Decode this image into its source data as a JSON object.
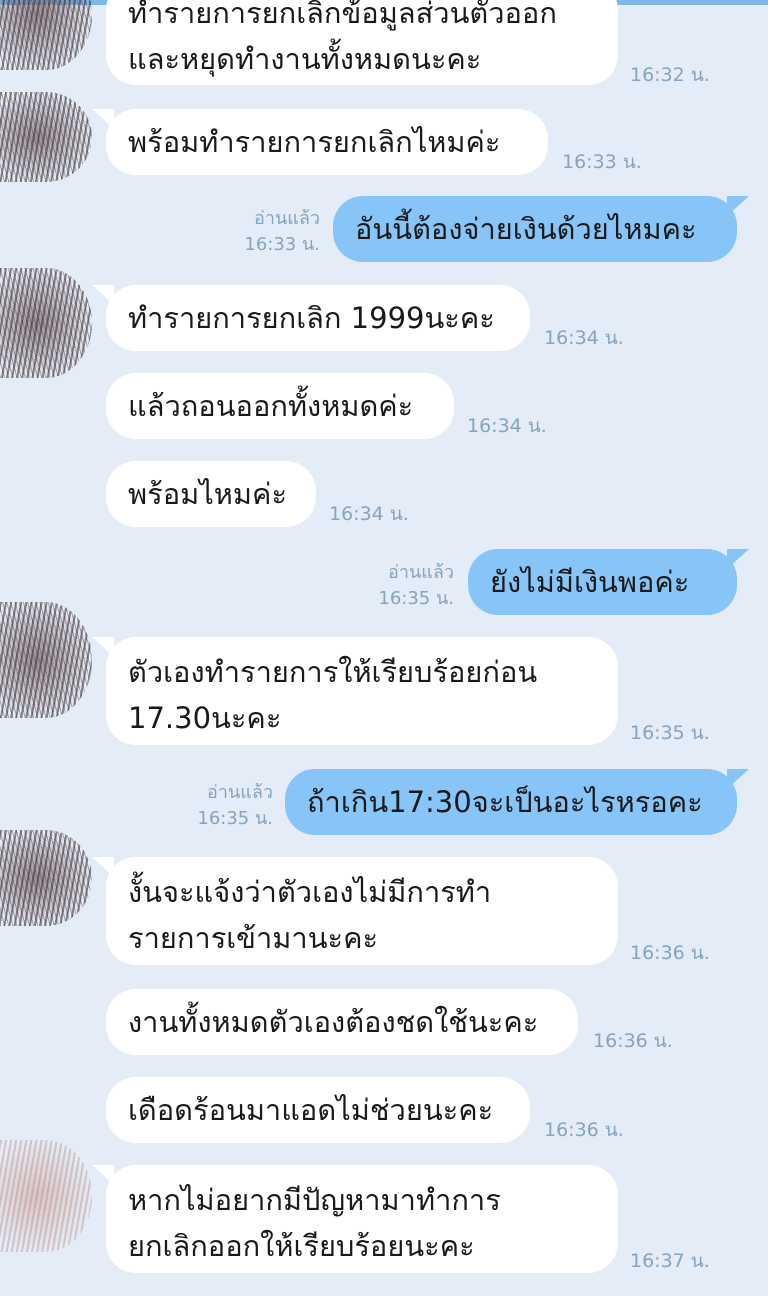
{
  "messages": [
    {
      "side": "in",
      "lines": [
        "ทำรายการยกเลิกข้อมูลส่วนตัวออก",
        "และหยุดทำงานทั้งหมดนะคะ"
      ],
      "time": "16:32 น."
    },
    {
      "side": "in",
      "lines": [
        "พร้อมทำรายการยกเลิกไหมค่ะ"
      ],
      "time": "16:33 น."
    },
    {
      "side": "out",
      "lines": [
        "อันนี้ต้องจ่ายเงินด้วยไหมคะ"
      ],
      "read": "อ่านแล้ว",
      "time": "16:33 น."
    },
    {
      "side": "in",
      "lines": [
        "ทำรายการยกเลิก 1999นะคะ"
      ],
      "time": "16:34 น."
    },
    {
      "side": "in",
      "lines": [
        "แล้วถอนออกทั้งหมดค่ะ"
      ],
      "time": "16:34 น."
    },
    {
      "side": "in",
      "lines": [
        "พร้อมไหมค่ะ"
      ],
      "time": "16:34 น."
    },
    {
      "side": "out",
      "lines": [
        "ยังไม่มีเงินพอค่ะ"
      ],
      "read": "อ่านแล้ว",
      "time": "16:35 น."
    },
    {
      "side": "in",
      "lines": [
        "ตัวเองทำรายการให้เรียบร้อยก่อน",
        "17.30นะคะ"
      ],
      "time": "16:35 น."
    },
    {
      "side": "out",
      "lines": [
        "ถ้าเกิน17:30จะเป็นอะไรหรอคะ"
      ],
      "read": "อ่านแล้ว",
      "time": "16:35 น."
    },
    {
      "side": "in",
      "lines": [
        "งั้นจะแจ้งว่าตัวเองไม่มีการทำ",
        "รายการเข้ามานะคะ"
      ],
      "time": "16:36 น."
    },
    {
      "side": "in",
      "lines": [
        "งานทั้งหมดตัวเองต้องชดใช้นะคะ"
      ],
      "time": "16:36 น."
    },
    {
      "side": "in",
      "lines": [
        "เดือดร้อนมาแอดไม่ช่วยนะคะ"
      ],
      "time": "16:36 น."
    },
    {
      "side": "in",
      "lines": [
        "หากไม่อยากมีปัญหามาทำการ",
        "ยกเลิกออกให้เรียบร้อยนะคะ"
      ],
      "time": "16:37 น."
    }
  ]
}
